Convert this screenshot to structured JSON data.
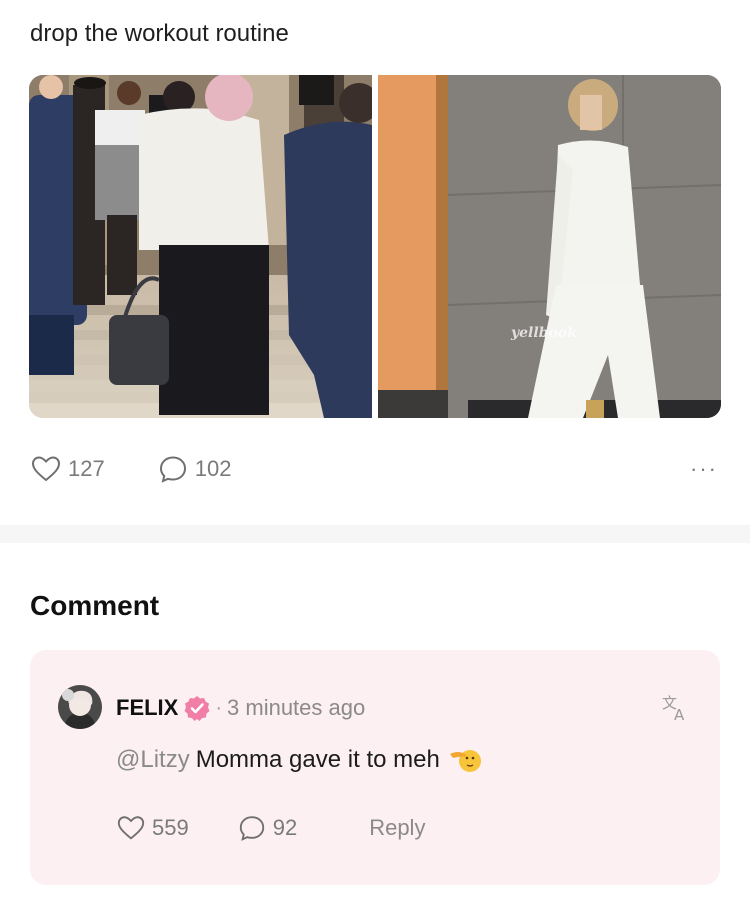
{
  "post": {
    "text": "drop the workout routine",
    "watermark": "yellbook",
    "likes": "127",
    "comments": "102",
    "more_label": "···",
    "icons": {
      "like": "heart-icon",
      "comment": "comment-bubble-icon",
      "more": "more-dots-icon"
    }
  },
  "section": {
    "title": "Comment"
  },
  "comment": {
    "author": "FELIX",
    "separator": "·",
    "time": "3 minutes ago",
    "mention": "@Litzy",
    "text": "Momma gave it to meh",
    "likes": "559",
    "replies": "92",
    "reply_label": "Reply",
    "icons": {
      "verified": "verified-badge-icon",
      "translate": "translate-icon",
      "emoji": "saluting-face-emoji"
    }
  },
  "colors": {
    "card_background": "#fdf0f3",
    "verified_badge": "#f07ea6",
    "muted_text": "#8a8a8a"
  }
}
